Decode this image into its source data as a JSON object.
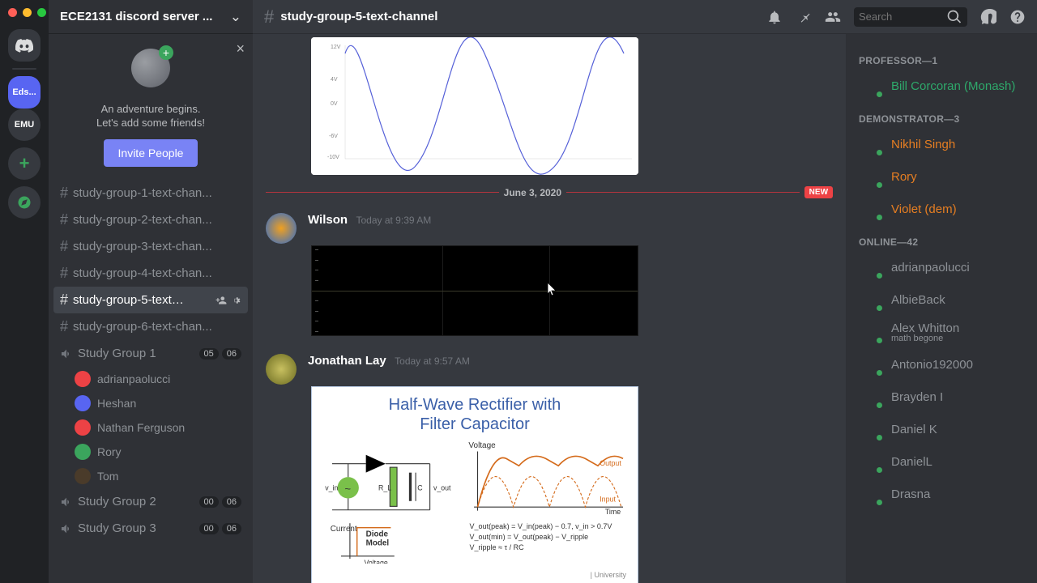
{
  "server": {
    "name": "ECE2131 discord server ..."
  },
  "channel_header": {
    "name": "study-group-5-text-channel"
  },
  "search": {
    "placeholder": "Search"
  },
  "guilds": [
    {
      "id": "eds",
      "label": "Eds...",
      "selected": true,
      "bg": "#5865f2"
    },
    {
      "id": "emu",
      "label": "EMU",
      "selected": false,
      "bg": "#36393f"
    }
  ],
  "adventure": {
    "line1": "An adventure begins.",
    "line2": "Let's add some friends!",
    "button": "Invite People"
  },
  "text_channels": [
    {
      "label": "study-group-1-text-chan...",
      "active": false
    },
    {
      "label": "study-group-2-text-chan...",
      "active": false
    },
    {
      "label": "study-group-3-text-chan...",
      "active": false
    },
    {
      "label": "study-group-4-text-chan...",
      "active": false
    },
    {
      "label": "study-group-5-text…",
      "active": true
    },
    {
      "label": "study-group-6-text-chan...",
      "active": false
    }
  ],
  "voice_channels": [
    {
      "label": "Study Group 1",
      "count": "05",
      "cap": "06",
      "users": [
        {
          "name": "adrianpaolucci",
          "color": "#ed4245"
        },
        {
          "name": "Heshan",
          "color": "#5865f2"
        },
        {
          "name": "Nathan Ferguson",
          "color": "#ed4245"
        },
        {
          "name": "Rory",
          "color": "#3ba55d"
        },
        {
          "name": "Tom",
          "color": "#4a3b2a"
        }
      ]
    },
    {
      "label": "Study Group 2",
      "count": "00",
      "cap": "06"
    },
    {
      "label": "Study Group 3",
      "count": "00",
      "cap": "06"
    }
  ],
  "divider": {
    "date": "June 3, 2020",
    "badge": "NEW"
  },
  "messages": [
    {
      "user": "Wilson",
      "ts": "Today at 9:39 AM",
      "avatar": "#f0a020"
    },
    {
      "user": "Jonathan Lay",
      "ts": "Today at 9:57 AM",
      "avatar": "#a8b030"
    }
  ],
  "slide": {
    "title_l1": "Half-Wave Rectifier with",
    "title_l2": "Filter Capacitor",
    "labels": {
      "voltage": "Voltage",
      "time": "Time",
      "output": "Output",
      "input": "Input",
      "current": "Current",
      "diode1": "Diode",
      "diode2": "Model",
      "voltage2": "Voltage",
      "uni": "| University"
    },
    "eq1": "V_out(peak) = V_in(peak) − 0.7,   v_in > 0.7V",
    "eq2": "V_out(min) = V_out(peak) − V_ripple",
    "eq3": "V_ripple  ≈  τ / RC"
  },
  "member_groups": [
    {
      "title": "PROFESSOR—1",
      "cls": "c-prof",
      "members": [
        {
          "name": "Bill Corcoran (Monash)",
          "av": "#7a5c3a"
        }
      ]
    },
    {
      "title": "DEMONSTRATOR—3",
      "cls": "c-demo",
      "members": [
        {
          "name": "Nikhil Singh",
          "av": "#5865f2"
        },
        {
          "name": "Rory",
          "av": "#5865f2"
        },
        {
          "name": "Violet (dem)",
          "av": "#3a2a1a"
        }
      ]
    },
    {
      "title": "ONLINE—42",
      "cls": "c-online",
      "members": [
        {
          "name": "adrianpaolucci",
          "av": "#ed4245"
        },
        {
          "name": "AlbieBack",
          "av": "#5865f2"
        },
        {
          "name": "Alex Whitton",
          "av": "#5865f2",
          "sub": "math begone"
        },
        {
          "name": "Antonio192000",
          "av": "#5865f2"
        },
        {
          "name": "Brayden I",
          "av": "#5865f2"
        },
        {
          "name": "Daniel K",
          "av": "#6a7a2a"
        },
        {
          "name": "DanielL",
          "av": "#5865f2"
        },
        {
          "name": "Drasna",
          "av": "#4a6a8a"
        }
      ]
    }
  ]
}
